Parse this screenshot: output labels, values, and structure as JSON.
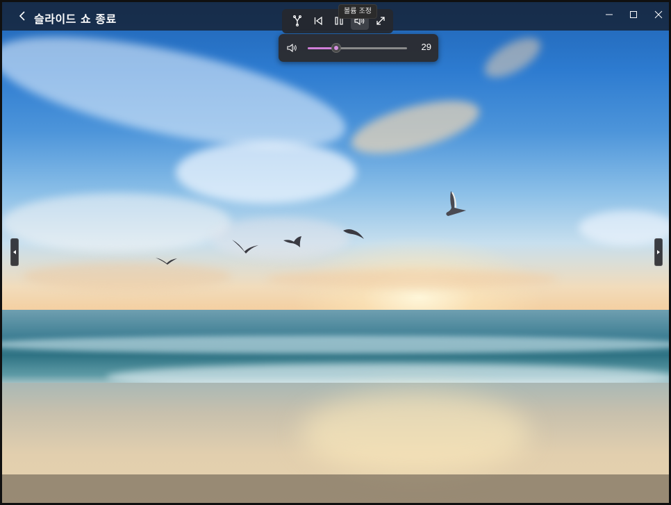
{
  "window": {
    "title": "슬라이드 쇼 종료",
    "back_icon": "chevron-left-icon",
    "controls": [
      "minimize-icon",
      "maximize-icon",
      "close-icon"
    ]
  },
  "toolbar": {
    "buttons": [
      {
        "name": "shuffle-button",
        "icon": "shuffle-icon"
      },
      {
        "name": "previous-button",
        "icon": "previous-icon"
      },
      {
        "name": "pause-button",
        "icon": "pause-icon"
      },
      {
        "name": "volume-button",
        "icon": "volume-icon"
      },
      {
        "name": "fullscreen-button",
        "icon": "expand-icon"
      }
    ],
    "tooltip": "볼륨 조정"
  },
  "volume": {
    "value": "29",
    "level_fraction": 0.29,
    "accent_color": "#d07fd8"
  },
  "navigation": {
    "prev_icon": "arrow-left-icon",
    "next_icon": "arrow-right-icon"
  },
  "photo": {
    "subject": "beach-sunset-photo"
  }
}
